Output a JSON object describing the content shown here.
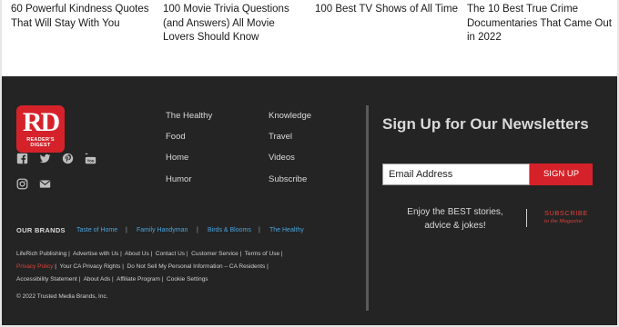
{
  "articles": [
    "60 Powerful Kindness Quotes That Will Stay With You",
    "100 Movie Trivia Questions (and Answers) All Movie Lovers Should Know",
    "100 Best TV Shows of All Time",
    "The 10 Best True Crime Documentaries That Came Out in 2022"
  ],
  "logo": {
    "letters": "RD",
    "subtitle_line1": "READER'S",
    "subtitle_line2": "DIGEST"
  },
  "social_icons": [
    "facebook-icon",
    "twitter-icon",
    "pinterest-icon",
    "youtube-icon",
    "instagram-icon",
    "email-icon"
  ],
  "nav": {
    "col1": [
      "The Healthy",
      "Food",
      "Home",
      "Humor"
    ],
    "col2": [
      "Knowledge",
      "Travel",
      "Videos",
      "Subscribe"
    ]
  },
  "brands": {
    "label": "OUR BRANDS",
    "items": [
      "Taste of Home",
      "Family Handyman",
      "Birds & Blooms",
      "The Healthy"
    ]
  },
  "legal": {
    "row1": [
      "LifeRich Publishing",
      "Advertise with Us",
      "About Us",
      "Contact Us",
      "Customer Service",
      "Terms of Use"
    ],
    "row2": [
      "Privacy Policy",
      "Your CA Privacy Rights",
      "Do Not Sell My Personal Information – CA Residents"
    ],
    "row3": [
      "Accessibility Statement",
      "About Ads",
      "Affiliate Program",
      "Cookie Settings"
    ]
  },
  "copyright": "© 2022 Trusted Media Brands, Inc.",
  "newsletter": {
    "title": "Sign Up for Our Newsletters",
    "email_placeholder": "Email Address",
    "button": "SIGN UP",
    "tagline": "Enjoy the BEST stories, advice & jokes!",
    "subscribe_line1": "SUBSCRIBE",
    "subscribe_line2": "to the Magazine"
  },
  "colors": {
    "footer_bg": "#242424",
    "brand_red": "#d5222a",
    "link_blue": "#4aa3df"
  }
}
